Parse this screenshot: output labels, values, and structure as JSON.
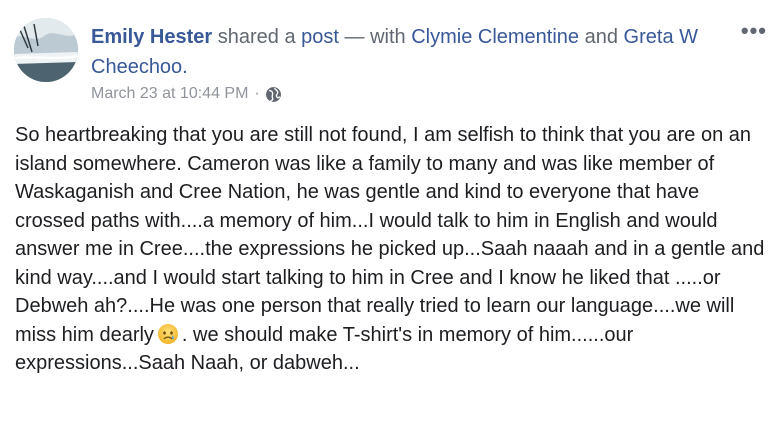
{
  "post": {
    "author": "Emily Hester",
    "action_text": "shared a",
    "post_link": "post",
    "with_text": "— with",
    "tagged_1": "Clymie Clementine",
    "and_text": "and",
    "tagged_2": "Greta W Cheechoo.",
    "timestamp": "March 23 at 10:44 PM",
    "separator": "·",
    "privacy_icon": "globe-icon",
    "more_label": "•••",
    "text_before_emoji": "So heartbreaking that you are still not found, I am selfish to think that you are on an island somewhere. Cameron was like a family to many and was like member of Waskaganish and Cree Nation, he was gentle and kind to everyone that have crossed paths with....a memory of him...I would talk to him in English and would answer me in Cree....the expressions he picked up...Saah naaah and in a gentle and kind way....and I would start talking to him in Cree and I know he liked that .....or Debweh ah?....He was one person that really tried to learn our language....we will miss him dearly",
    "emoji": "sad-face-icon",
    "text_after_emoji": ". we should make T-shirt's in memory of him......our expressions...Saah Naah, or dabweh..."
  }
}
